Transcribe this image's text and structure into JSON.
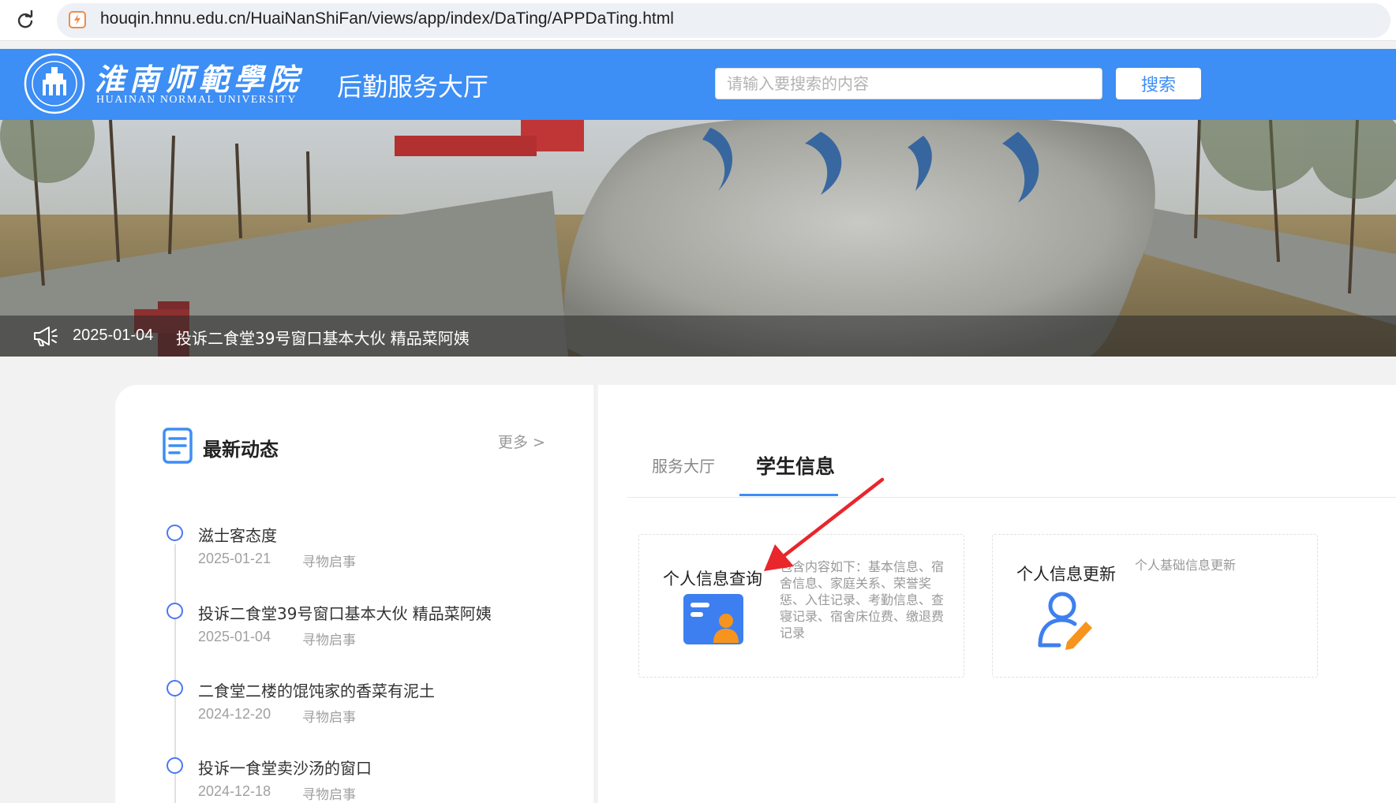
{
  "browser": {
    "url": "houqin.hnnu.edu.cn/HuaiNanShiFan/views/app/index/DaTing/APPDaTing.html",
    "reload_icon": "reload-icon",
    "site_icon": "site-favicon-icon"
  },
  "header": {
    "logo_cn": "淮南师範學院",
    "logo_en": "HUAINAN NORMAL UNIVERSITY",
    "site_name": "后勤服务大厅",
    "search_placeholder": "请输入要搜索的内容",
    "search_button": "搜索",
    "bg_color": "#3d8ef5"
  },
  "banner": {
    "notice_date": "2025-01-04",
    "notice_title": "投诉二食堂39号窗口基本大伙 精品菜阿姨",
    "notice_icon": "megaphone-icon"
  },
  "news": {
    "heading": "最新动态",
    "more": "更多 >",
    "items": [
      {
        "title": "滋士客态度",
        "date": "2025-01-21",
        "category": "寻物启事"
      },
      {
        "title": "投诉二食堂39号窗口基本大伙 精品菜阿姨",
        "date": "2025-01-04",
        "category": "寻物启事"
      },
      {
        "title": "二食堂二楼的馄饨家的香菜有泥土",
        "date": "2024-12-20",
        "category": "寻物启事"
      },
      {
        "title": "投诉一食堂卖沙汤的窗口",
        "date": "2024-12-18",
        "category": "寻物启事"
      }
    ]
  },
  "services": {
    "tabs": [
      {
        "label": "服务大厅",
        "active": false
      },
      {
        "label": "学生信息",
        "active": true
      }
    ],
    "cards": [
      {
        "title": "个人信息查询",
        "desc": "包含内容如下：基本信息、宿舍信息、家庭关系、荣誉奖惩、入住记录、考勤信息、查寝记录、宿舍床位费、缴退费记录",
        "icon": "id-card-icon"
      },
      {
        "title": "个人信息更新",
        "desc": "个人基础信息更新",
        "icon": "user-edit-icon"
      }
    ]
  },
  "colors": {
    "accent": "#3d8ef5",
    "timeline_dot": "#4a78f0",
    "annotation": "#e8262b",
    "icon_orange": "#f7941d"
  }
}
